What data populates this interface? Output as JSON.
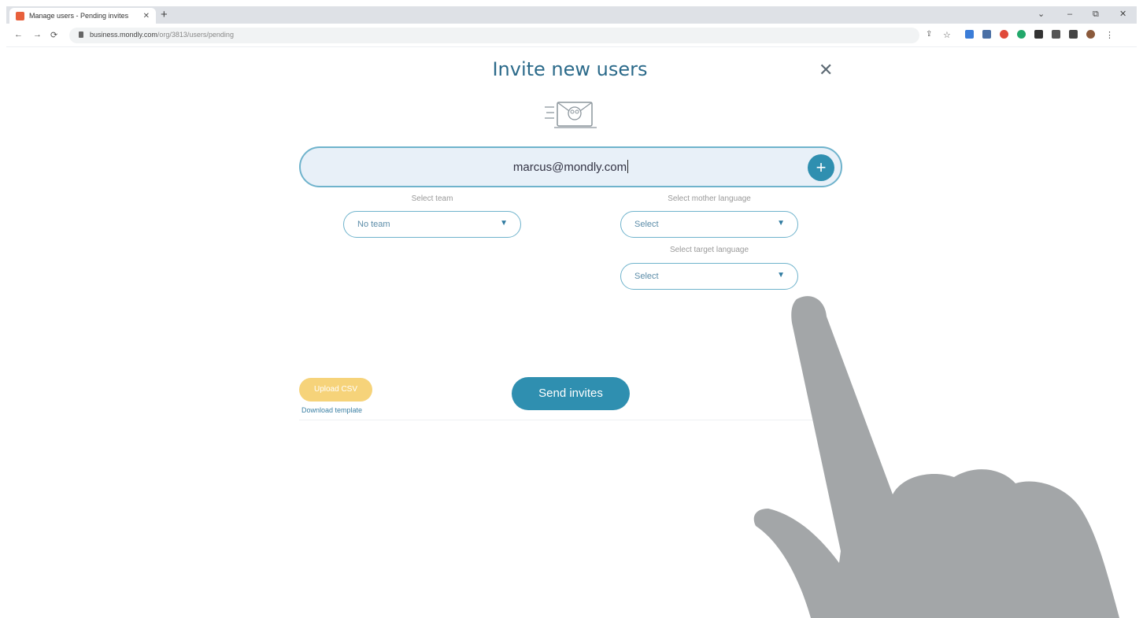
{
  "browser": {
    "tab_title": "Manage users - Pending invites",
    "tab_close": "✕",
    "new_tab": "+",
    "url_domain": "business.mondly.com",
    "url_path": "/org/3813/users/pending",
    "window_controls": {
      "minimize": "–",
      "maximize": "⧉",
      "close": "✕",
      "tab_menu": "⌄"
    },
    "nav": {
      "back": "←",
      "forward": "→",
      "reload": "⟳"
    }
  },
  "modal": {
    "title": "Invite new users",
    "close": "✕",
    "email_value": "marcus@mondly.com",
    "add_button": "+",
    "team": {
      "label": "Select team",
      "value": "No team"
    },
    "mother_language": {
      "label": "Select mother language",
      "value": "Select"
    },
    "target_language": {
      "label": "Select target language",
      "value": "Select"
    },
    "dropdown_arrow": "▼",
    "upload_csv": "Upload CSV",
    "download_template": "Download template",
    "send_invites": "Send invites"
  },
  "colors": {
    "brand_blue": "#2f8fb0",
    "title_blue": "#2b6a8a",
    "upload_yellow": "#f6d37a",
    "email_bg": "#e8f0f8",
    "hand_gray": "#a3a6a8"
  }
}
